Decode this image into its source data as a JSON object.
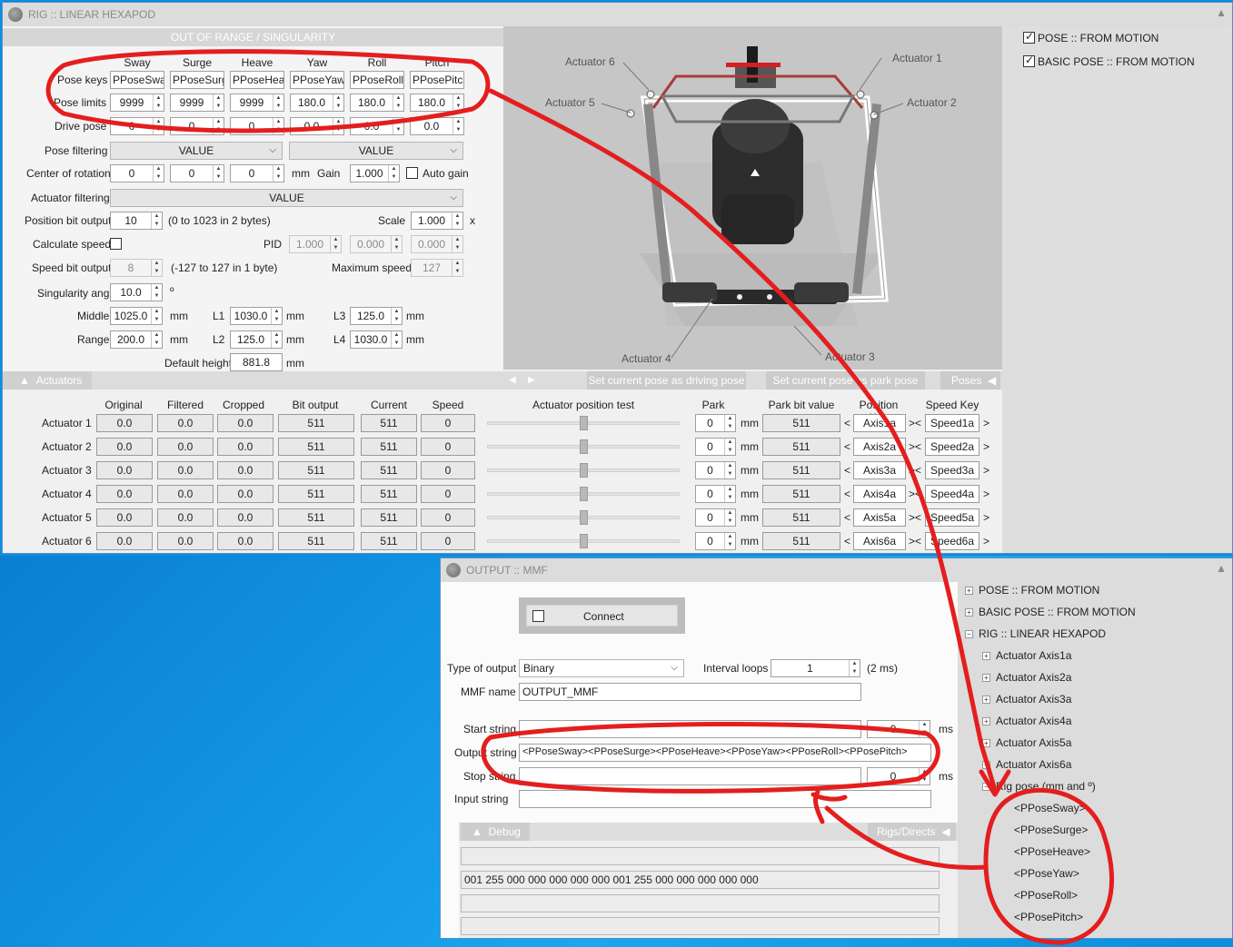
{
  "rig_window": {
    "title": "RIG :: LINEAR HEXAPOD",
    "section_out_of_range": "OUT OF RANGE / SINGULARITY",
    "dof_headers": [
      "Sway",
      "Surge",
      "Heave",
      "Yaw",
      "Roll",
      "Pitch"
    ],
    "pose_keys_label": "Pose keys",
    "pose_keys": [
      "PPoseSway",
      "PPoseSurge",
      "PPoseHeave",
      "PPoseYaw",
      "PPoseRoll",
      "PPosePitch"
    ],
    "pose_limits_label": "Pose limits",
    "pose_limits": [
      "9999",
      "9999",
      "9999",
      "180.0",
      "180.0",
      "180.0"
    ],
    "drive_pose_label": "Drive pose",
    "drive_pose": [
      "0",
      "0",
      "0",
      "0.0",
      "0.0",
      "0.0"
    ],
    "pose_filtering_label": "Pose filtering",
    "pose_filtering_values": [
      "VALUE",
      "VALUE"
    ],
    "center_rotation_label": "Center of rotation",
    "center_rotation": [
      "0",
      "0",
      "0"
    ],
    "mm_unit": "mm",
    "gain_label": "Gain",
    "gain": "1.000",
    "auto_gain_label": "Auto gain",
    "actuator_filtering_label": "Actuator filtering",
    "actuator_filtering_value": "VALUE",
    "position_bit_output_label": "Position bit output",
    "position_bit_output": "10",
    "position_bit_hint": "(0 to 1023 in 2 bytes)",
    "scale_label": "Scale",
    "scale": "1.000",
    "scale_unit": "x",
    "calculate_speed_label": "Calculate speed",
    "pid_label": "PID",
    "pid": [
      "1.000",
      "0.000",
      "0.000"
    ],
    "speed_bit_output_label": "Speed bit output",
    "speed_bit_output": "8",
    "speed_bit_hint": "(-127 to 127 in 1 byte)",
    "max_speed_label": "Maximum speed",
    "max_speed": "127",
    "singularity_angle_label": "Singularity angle",
    "singularity_angle": "10.0",
    "degree_unit": "º",
    "middle_label": "Middle",
    "middle": "1025.0",
    "range_label": "Range",
    "range": "200.0",
    "l1_label": "L1",
    "l1": "1030.0",
    "l2_label": "L2",
    "l2": "125.0",
    "l3_label": "L3",
    "l3": "125.0",
    "l4_label": "L4",
    "l4": "1030.0",
    "default_height_label": "Default height",
    "default_height": "881.8",
    "actuator_labels_3d": [
      "Actuator 1",
      "Actuator 2",
      "Actuator 3",
      "Actuator 4",
      "Actuator 5",
      "Actuator 6"
    ],
    "actuators_tab": "Actuators",
    "set_driving_pose": "Set current pose as driving pose",
    "set_park_pose": "Set current pose as park pose",
    "poses_tab": "Poses",
    "right_checks": [
      {
        "label": "POSE :: FROM MOTION",
        "checked": true
      },
      {
        "label": "BASIC POSE :: FROM MOTION",
        "checked": true
      }
    ],
    "table_headers": [
      "Original",
      "Filtered",
      "Cropped",
      "Bit output",
      "Current",
      "Speed",
      "Actuator position test",
      "Park",
      "Park bit value",
      "Position Key",
      "Speed Key"
    ],
    "actuators": [
      {
        "name": "Actuator 1",
        "original": "0.0",
        "filtered": "0.0",
        "cropped": "0.0",
        "bit": "511",
        "current": "511",
        "speed": "0",
        "test": 0.5,
        "park": "0",
        "park_bit": "511",
        "pos_key": "Axis1a",
        "speed_key": "Speed1a"
      },
      {
        "name": "Actuator 2",
        "original": "0.0",
        "filtered": "0.0",
        "cropped": "0.0",
        "bit": "511",
        "current": "511",
        "speed": "0",
        "test": 0.5,
        "park": "0",
        "park_bit": "511",
        "pos_key": "Axis2a",
        "speed_key": "Speed2a"
      },
      {
        "name": "Actuator 3",
        "original": "0.0",
        "filtered": "0.0",
        "cropped": "0.0",
        "bit": "511",
        "current": "511",
        "speed": "0",
        "test": 0.5,
        "park": "0",
        "park_bit": "511",
        "pos_key": "Axis3a",
        "speed_key": "Speed3a"
      },
      {
        "name": "Actuator 4",
        "original": "0.0",
        "filtered": "0.0",
        "cropped": "0.0",
        "bit": "511",
        "current": "511",
        "speed": "0",
        "test": 0.5,
        "park": "0",
        "park_bit": "511",
        "pos_key": "Axis4a",
        "speed_key": "Speed4a"
      },
      {
        "name": "Actuator 5",
        "original": "0.0",
        "filtered": "0.0",
        "cropped": "0.0",
        "bit": "511",
        "current": "511",
        "speed": "0",
        "test": 0.5,
        "park": "0",
        "park_bit": "511",
        "pos_key": "Axis5a",
        "speed_key": "Speed5a"
      },
      {
        "name": "Actuator 6",
        "original": "0.0",
        "filtered": "0.0",
        "cropped": "0.0",
        "bit": "511",
        "current": "511",
        "speed": "0",
        "test": 0.5,
        "park": "0",
        "park_bit": "511",
        "pos_key": "Axis6a",
        "speed_key": "Speed6a"
      }
    ]
  },
  "output_window": {
    "title": "OUTPUT :: MMF",
    "connect_label": "Connect",
    "type_of_output_label": "Type of output",
    "type_of_output": "Binary",
    "interval_loops_label": "Interval loops",
    "interval_loops": "1",
    "interval_hint": "(2 ms)",
    "mmf_name_label": "MMF name",
    "mmf_name": "OUTPUT_MMF",
    "start_string_label": "Start string",
    "start_string": "",
    "start_ms": "0",
    "ms_unit": "ms",
    "output_string_label": "Output string",
    "output_string": "<PPoseSway><PPoseSurge><PPoseHeave><PPoseYaw><PPoseRoll><PPosePitch>",
    "stop_string_label": "Stop string",
    "stop_string": "",
    "stop_ms": "0",
    "input_string_label": "Input string",
    "input_string": "",
    "debug_tab": "Debug",
    "rigs_directs_tab": "Rigs/Directs",
    "debug_lines": [
      "",
      "001 255 000 000 000 000 000 001 255 000 000 000 000 000",
      "",
      ""
    ],
    "tree": {
      "top": [
        {
          "label": "POSE :: FROM MOTION",
          "expand": "+"
        },
        {
          "label": "BASIC POSE :: FROM MOTION",
          "expand": "+"
        },
        {
          "label": "RIG :: LINEAR HEXAPOD",
          "expand": "−"
        }
      ],
      "children": [
        "Actuator Axis1a",
        "Actuator Axis2a",
        "Actuator Axis3a",
        "Actuator Axis4a",
        "Actuator Axis5a",
        "Actuator Axis6a"
      ],
      "rig_pose_label": "Rig pose (mm and º)",
      "pose_keys": [
        "<PPoseSway>",
        "<PPoseSurge>",
        "<PPoseHeave>",
        "<PPoseYaw>",
        "<PPoseRoll>",
        "<PPosePitch>"
      ]
    }
  },
  "colors": {
    "annotation_red": "#e41e1e",
    "desktop_blue": "#0a8fdc",
    "window_bg": "#f0f0f0"
  }
}
